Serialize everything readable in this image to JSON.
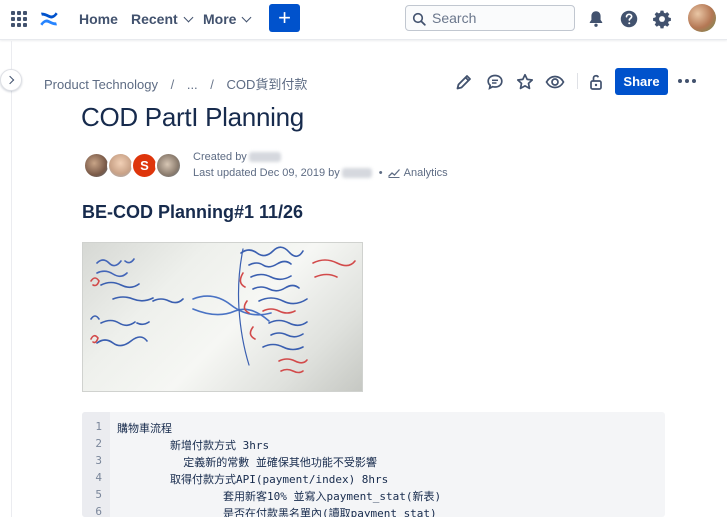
{
  "topnav": {
    "home_label": "Home",
    "recent_label": "Recent",
    "more_label": "More",
    "create_label": "+",
    "search_placeholder": "Search"
  },
  "breadcrumb": {
    "items": [
      "Product Technology",
      "...",
      "COD貨到付款"
    ],
    "separator": "/"
  },
  "page_actions": {
    "share_label": "Share"
  },
  "page": {
    "title": "COD PartI Planning",
    "created_by_label": "Created by",
    "last_updated_label": "Last updated Dec 09, 2019 by",
    "analytics_label": "Analytics",
    "contributor_initial": "S",
    "section_heading": "BE-COD Planning#1 11/26"
  },
  "code_block": {
    "lines": [
      {
        "num": "1",
        "text": "購物車流程"
      },
      {
        "num": "2",
        "text": "        新增付款方式 3hrs"
      },
      {
        "num": "3",
        "text": "          定義新的常數 並確保其他功能不受影響"
      },
      {
        "num": "4",
        "text": "        取得付款方式API(payment/index) 8hrs"
      },
      {
        "num": "5",
        "text": "                套用新客10% 並寫入payment_stat(新表)"
      },
      {
        "num": "6",
        "text": "                是否在付款黑名單內(讀取payment_stat)"
      }
    ]
  },
  "colors": {
    "primary": "#0052cc",
    "text": "#172b4d",
    "subtle_text": "#5e6c84",
    "avatar_s": "#de350b"
  },
  "icons": {
    "apps": "apps-grid-icon",
    "logo": "confluence-logo-icon",
    "search": "search-icon",
    "notifications": "bell-icon",
    "help": "help-icon",
    "settings": "gear-icon",
    "edit": "pencil-icon",
    "comment": "comment-icon",
    "star": "star-icon",
    "watch": "eye-icon",
    "restrictions": "unlock-icon",
    "more": "more-dots-icon",
    "analytics": "analytics-icon"
  }
}
